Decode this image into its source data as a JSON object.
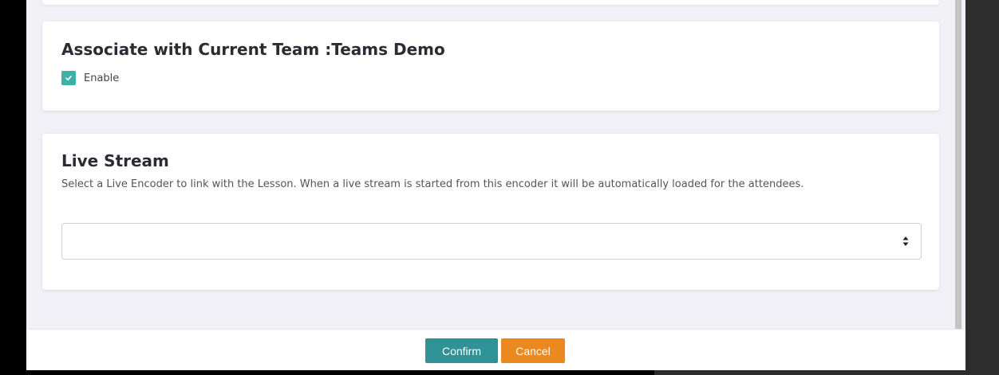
{
  "team_section": {
    "title": "Associate with Current Team :Teams Demo",
    "enable_label": "Enable",
    "enabled": true
  },
  "live_stream": {
    "title": "Live Stream",
    "description": "Select a Live Encoder to link with the Lesson. When a live stream is started from this encoder it will be automatically loaded for the attendees.",
    "selected_value": ""
  },
  "footer": {
    "confirm_label": "Confirm",
    "cancel_label": "Cancel"
  },
  "colors": {
    "checkbox": "#3fb0a8",
    "confirm": "#2f9296",
    "cancel": "#e98920",
    "panel_background": "#f1f0f6"
  },
  "icons": {
    "checkbox": "check-icon",
    "select": "sort-arrows-icon"
  }
}
